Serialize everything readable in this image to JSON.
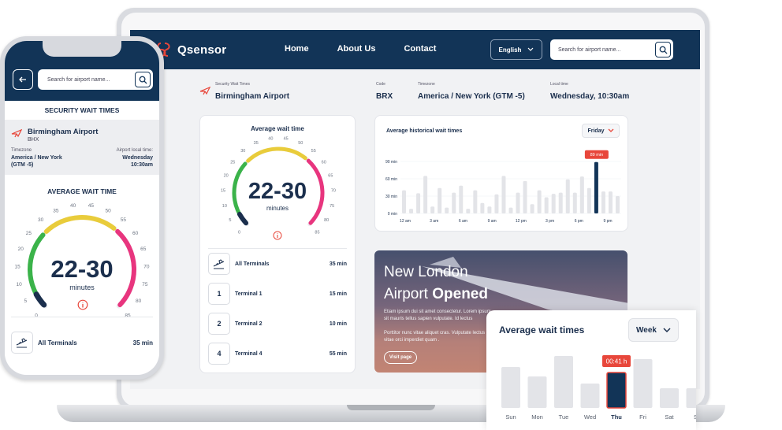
{
  "header": {
    "brand": "Qsensor",
    "nav": [
      "Home",
      "About Us",
      "Contact"
    ],
    "language": "English",
    "search_placeholder": "Search for airport name..."
  },
  "airport_info": {
    "security_label": "Security Wait Times",
    "airport_name": "Birmingham Airport",
    "code_label": "Code",
    "code": "BRX",
    "timezone_label": "Timezone",
    "timezone": "America / New York (GTM -5)",
    "localtime_label": "Local time",
    "localtime": "Wednesday, 10:30am"
  },
  "gauge": {
    "title": "Average wait time",
    "value": "22-30",
    "unit": "minutes",
    "ticks": [
      "0",
      "5",
      "10",
      "15",
      "20",
      "25",
      "30",
      "35",
      "40",
      "45",
      "50",
      "55",
      "60",
      "65",
      "70",
      "75",
      "80",
      "85"
    ]
  },
  "terminals": [
    {
      "icon": "plane-takeoff-icon",
      "name": "All Terminals",
      "wait": "35 min"
    },
    {
      "badge": "1",
      "name": "Terminal 1",
      "wait": "15 min"
    },
    {
      "badge": "2",
      "name": "Terminal 2",
      "wait": "10 min"
    },
    {
      "badge": "4",
      "name": "Terminal 4",
      "wait": "55 min"
    }
  ],
  "history": {
    "title": "Average historical wait times",
    "day": "Friday",
    "y_labels": [
      "90 min",
      "60 min",
      "30 min",
      "0 min"
    ],
    "x_labels": [
      "12 am",
      "3 am",
      "6 am",
      "9 am",
      "12 pm",
      "3 pm",
      "6 pm",
      "9 pm"
    ],
    "highlight_label": "89 min"
  },
  "news": {
    "title_light": "New London",
    "title_light2": "Airport",
    "title_bold": "Opened",
    "p1": "Etiam ipsum dui sit amet consectetur. Lorem ipsum sit mauris tellus sapien vulputate. Id lectus",
    "p2": "Porttitor nunc vitae aliquet cras. Vulputate lectus vitae orci imperdiet quam .",
    "button": "Visit page"
  },
  "phone": {
    "search_placeholder": "Search for airport name...",
    "section_title": "SECURITY WAIT TIMES",
    "airport_name": "Birmingham Airport",
    "airport_code": "BHX",
    "timezone_label": "Timezone",
    "timezone_line1": "America / New York",
    "timezone_line2": "(GTM -5)",
    "localtime_label": "Airport local time:",
    "localtime_line1": "Wednesday",
    "localtime_line2": "10:30am",
    "wait_title": "AVERAGE WAIT TIME",
    "gauge_value": "22-30",
    "gauge_unit": "minutes",
    "all_terminals": "All Terminals",
    "all_terminals_wait": "35 min"
  },
  "weekly": {
    "title": "Average wait times",
    "period": "Week",
    "days": [
      "Sun",
      "Mon",
      "Tue",
      "Wed",
      "Thu",
      "Fri",
      "Sat",
      "S"
    ],
    "highlight_label": "00:41 h"
  },
  "chart_data": [
    {
      "type": "bar",
      "title": "Average historical wait times",
      "subtitle": "Friday",
      "ylim": [
        0,
        90
      ],
      "y_ticks": [
        "0 min",
        "30 min",
        "60 min",
        "90 min"
      ],
      "x_ticks": [
        "12 am",
        "3 am",
        "6 am",
        "9 am",
        "12 pm",
        "3 pm",
        "6 pm",
        "9 pm"
      ],
      "values": [
        40,
        8,
        35,
        65,
        12,
        44,
        10,
        36,
        48,
        8,
        40,
        18,
        12,
        33,
        65,
        10,
        36,
        56,
        16,
        40,
        28,
        34,
        36,
        59,
        36,
        64,
        44,
        89,
        38,
        38,
        30
      ],
      "highlight_index": 27,
      "highlight_label": "89 min"
    },
    {
      "type": "bar",
      "title": "Average wait times",
      "subtitle": "Week",
      "categories": [
        "Sun",
        "Mon",
        "Tue",
        "Wed",
        "Thu",
        "Fri",
        "Sat"
      ],
      "values": [
        52,
        40,
        66,
        31,
        45,
        62,
        25
      ],
      "highlight_index": 4,
      "highlight_label": "00:41 h"
    }
  ],
  "colors": {
    "navy": "#123457",
    "accent_red": "#e8473b",
    "bar_gray": "#e3e4e8",
    "gauge_green": "#3bb34a",
    "gauge_yellow": "#e9cc3b",
    "gauge_pink": "#e8357e"
  }
}
